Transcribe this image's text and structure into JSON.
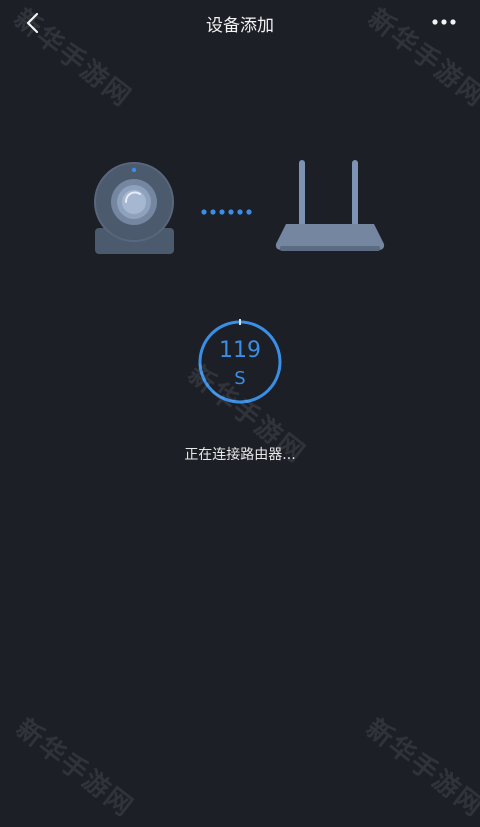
{
  "header": {
    "title": "设备添加",
    "back_icon": "chevron-left-icon",
    "more_icon": "more-horizontal-icon"
  },
  "illustration": {
    "camera_icon": "camera-icon",
    "router_icon": "router-icon",
    "connecting_dots": 6,
    "accent_color": "#3a8ee6"
  },
  "countdown": {
    "value": "119",
    "unit": "S",
    "progress_fraction": 0.99
  },
  "status": {
    "text": "正在连接路由器..."
  },
  "watermark": {
    "text": "新华手游网"
  }
}
